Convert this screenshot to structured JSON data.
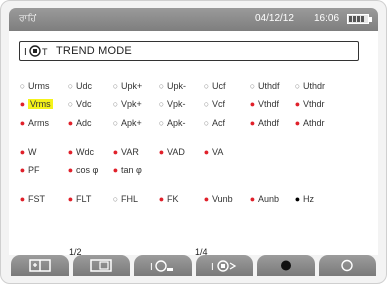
{
  "status": {
    "logo": "ਰਾਹਿਂ",
    "date": "04/12/12",
    "time": "16:06",
    "battery_icon": "battery-icon"
  },
  "title": {
    "icon": "trend-mode-icon",
    "text": "TREND MODE"
  },
  "rows": [
    [
      {
        "label": "Urms",
        "state": "off"
      },
      {
        "label": "Udc",
        "state": "off"
      },
      {
        "label": "Upk+",
        "state": "off"
      },
      {
        "label": "Upk-",
        "state": "off"
      },
      {
        "label": "Ucf",
        "state": "off"
      },
      {
        "label": "Uthdf",
        "state": "off"
      },
      {
        "label": "Uthdr",
        "state": "off"
      }
    ],
    [
      {
        "label": "Vrms",
        "state": "on",
        "highlighted": true
      },
      {
        "label": "Vdc",
        "state": "off"
      },
      {
        "label": "Vpk+",
        "state": "off"
      },
      {
        "label": "Vpk-",
        "state": "off"
      },
      {
        "label": "Vcf",
        "state": "off"
      },
      {
        "label": "Vthdf",
        "state": "on"
      },
      {
        "label": "Vthdr",
        "state": "on"
      }
    ],
    [
      {
        "label": "Arms",
        "state": "on"
      },
      {
        "label": "Adc",
        "state": "on"
      },
      {
        "label": "Apk+",
        "state": "off"
      },
      {
        "label": "Apk-",
        "state": "off"
      },
      {
        "label": "Acf",
        "state": "off"
      },
      {
        "label": "Athdf",
        "state": "on"
      },
      {
        "label": "Athdr",
        "state": "on"
      }
    ],
    [
      {
        "label": "W",
        "state": "on"
      },
      {
        "label": "Wdc",
        "state": "on"
      },
      {
        "label": "VAR",
        "state": "on"
      },
      {
        "label": "VAD",
        "state": "on"
      },
      {
        "label": "VA",
        "state": "on"
      }
    ],
    [
      {
        "label": "PF",
        "state": "on"
      },
      {
        "label": "cos φ",
        "state": "on"
      },
      {
        "label": "tan φ",
        "state": "on"
      }
    ],
    [
      {
        "label": "FST",
        "state": "on"
      },
      {
        "label": "FLT",
        "state": "on"
      },
      {
        "label": "FHL",
        "state": "off"
      },
      {
        "label": "FK",
        "state": "on"
      },
      {
        "label": "Vunb",
        "state": "on"
      },
      {
        "label": "Aunb",
        "state": "on"
      },
      {
        "label": "Hz",
        "state": "black"
      }
    ]
  ],
  "pages": {
    "left": "1/2",
    "right": "1/4"
  },
  "function_buttons": [
    {
      "name": "config-screen-icon"
    },
    {
      "name": "screen-icon"
    },
    {
      "name": "trend-record-icon"
    },
    {
      "name": "trend-view-icon"
    },
    {
      "name": "record-dot-icon"
    },
    {
      "name": "circle-icon"
    }
  ]
}
